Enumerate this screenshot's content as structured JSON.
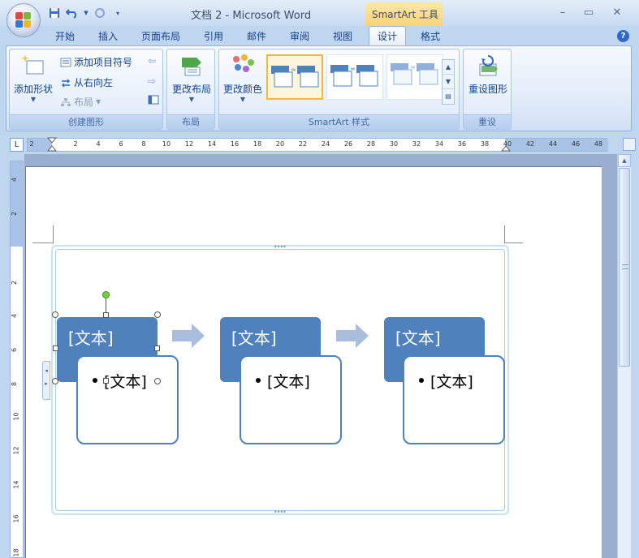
{
  "window": {
    "title": "文档 2 - Microsoft Word",
    "context_tab_title": "SmartArt 工具",
    "minimize": "–",
    "maximize": "▭",
    "close": "✕"
  },
  "quick_access": {
    "save_icon": "save-icon",
    "undo_icon": "undo-icon",
    "redo_icon": "redo-icon",
    "customize_icon": "customize-qat-icon"
  },
  "tabs": [
    {
      "label": "开始",
      "active": false
    },
    {
      "label": "插入",
      "active": false
    },
    {
      "label": "页面布局",
      "active": false
    },
    {
      "label": "引用",
      "active": false
    },
    {
      "label": "邮件",
      "active": false
    },
    {
      "label": "审阅",
      "active": false
    },
    {
      "label": "视图",
      "active": false
    },
    {
      "label": "设计",
      "active": true
    },
    {
      "label": "格式",
      "active": false
    }
  ],
  "ribbon": {
    "create_graphic": {
      "label": "创建图形",
      "add_shape": "添加形状",
      "add_bullet": "添加项目符号",
      "right_to_left": "从右向左",
      "layout": "布局"
    },
    "layouts": {
      "label": "布局",
      "change_layout": "更改布局"
    },
    "smartart_styles": {
      "label": "SmartArt 样式",
      "change_colors": "更改颜色"
    },
    "reset": {
      "label": "重设",
      "reset_graphic": "重设图形"
    }
  },
  "ruler": {
    "corner": "L",
    "h_ticks": [
      "2",
      "2",
      "4",
      "6",
      "8",
      "10",
      "12",
      "14",
      "16",
      "18",
      "20",
      "22",
      "24",
      "26",
      "28",
      "30",
      "32",
      "34",
      "36",
      "38",
      "40",
      "42",
      "44",
      "46",
      "48"
    ],
    "v_ticks": [
      "4",
      "2",
      "2",
      "4",
      "6",
      "8",
      "10",
      "12",
      "14",
      "16",
      "18"
    ]
  },
  "smartart": {
    "nodes": [
      {
        "title": "[文本]",
        "bullet": "[文本]",
        "selected": true
      },
      {
        "title": "[文本]",
        "bullet": "[文本]",
        "selected": false
      },
      {
        "title": "[文本]",
        "bullet": "[文本]",
        "selected": false
      }
    ]
  },
  "colors": {
    "node_fill": "#4f81bd",
    "arrow_fill": "#a9bddc",
    "ribbon_text": "#15428b"
  }
}
